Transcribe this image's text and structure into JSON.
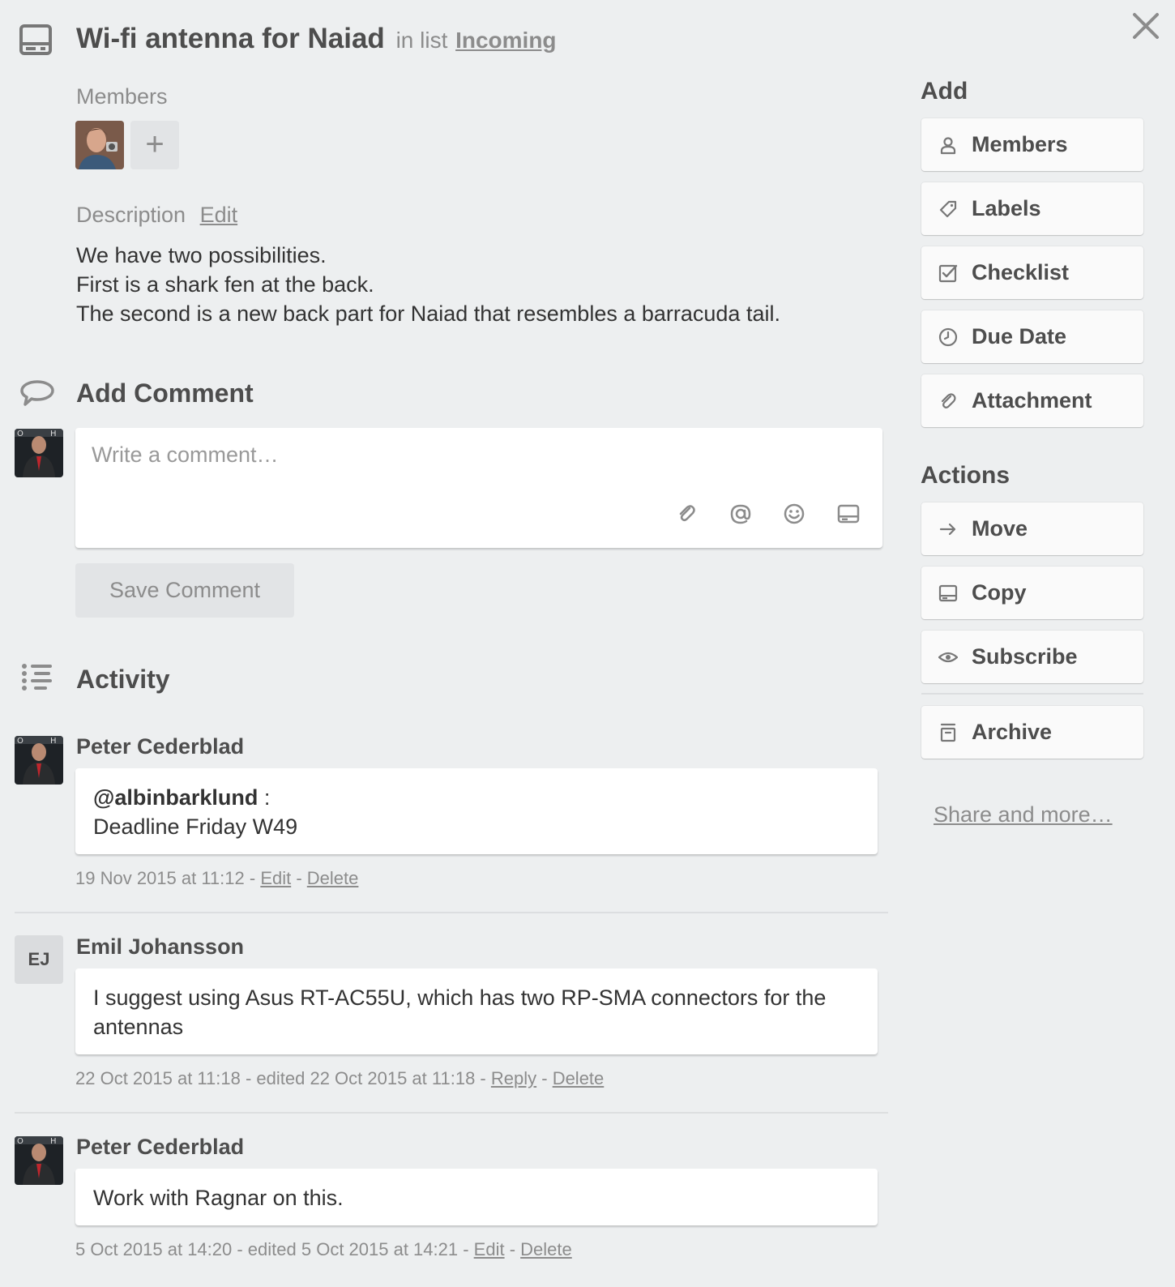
{
  "card": {
    "title": "Wi-fi antenna for Naiad",
    "in_list_prefix": "in list",
    "list_name": "Incoming"
  },
  "members": {
    "label": "Members",
    "add_symbol": "+"
  },
  "description": {
    "label": "Description",
    "edit_link": "Edit",
    "text": "We have two possibilities.\nFirst is a shark fen at the back.\nThe second is a new back part for Naiad that resembles a barracuda tail."
  },
  "add_comment": {
    "title": "Add Comment",
    "placeholder": "Write a comment…",
    "save_label": "Save Comment",
    "toolbar_icons": [
      "attachment-icon",
      "mention-icon",
      "emoji-icon",
      "card-icon"
    ]
  },
  "activity": {
    "title": "Activity",
    "entries": [
      {
        "author": "Peter Cederblad",
        "mention": "@albinbarklund",
        "mention_suffix": " :",
        "text": "Deadline Friday W49",
        "meta": "19 Nov 2015 at 11:12 - ",
        "action1": "Edit",
        "separator": " - ",
        "action2": "Delete"
      },
      {
        "author": "Emil Johansson",
        "initials": "EJ",
        "text": "I suggest using Asus RT-AC55U, which has two RP-SMA connectors for the antennas",
        "meta": "22 Oct 2015 at 11:18 - edited 22 Oct 2015 at 11:18 - ",
        "action1": "Reply",
        "separator": " - ",
        "action2": "Delete"
      },
      {
        "author": "Peter Cederblad",
        "text": "Work with Ragnar on this.",
        "meta": "5 Oct 2015 at 14:20 - edited 5 Oct 2015 at 14:21 - ",
        "action1": "Edit",
        "separator": " - ",
        "action2": "Delete"
      }
    ]
  },
  "sidebar": {
    "add_heading": "Add",
    "add_buttons": [
      {
        "label": "Members",
        "icon": "person-icon"
      },
      {
        "label": "Labels",
        "icon": "tag-icon"
      },
      {
        "label": "Checklist",
        "icon": "checkbox-icon"
      },
      {
        "label": "Due Date",
        "icon": "clock-icon"
      },
      {
        "label": "Attachment",
        "icon": "paperclip-icon"
      }
    ],
    "actions_heading": "Actions",
    "action_buttons": [
      {
        "label": "Move",
        "icon": "arrow-right-icon"
      },
      {
        "label": "Copy",
        "icon": "card-icon"
      },
      {
        "label": "Subscribe",
        "icon": "eye-icon"
      },
      {
        "label": "Archive",
        "icon": "archive-icon"
      }
    ],
    "share_link": "Share and more…"
  },
  "colors": {
    "background": "#edeff0",
    "text": "#4d4d4d",
    "muted": "#8c8c8c",
    "button_bg": "#fafafa"
  }
}
